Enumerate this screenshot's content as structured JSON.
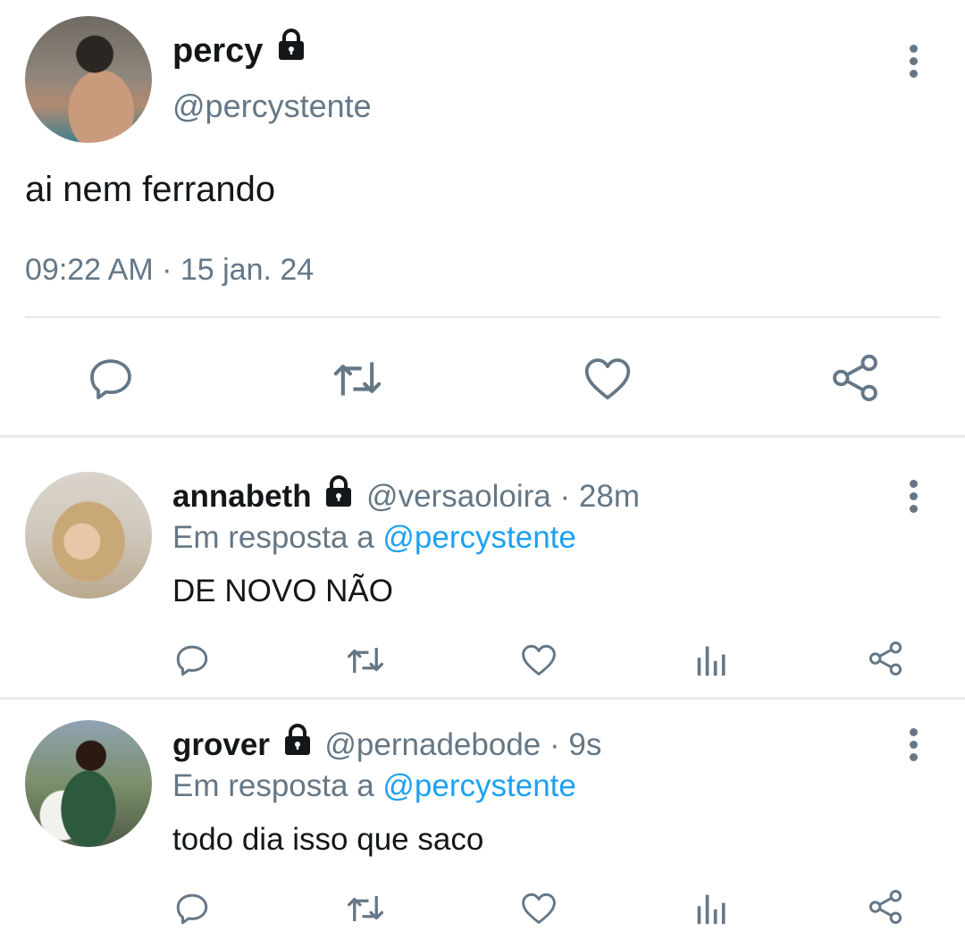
{
  "main_tweet": {
    "display_name": "percy",
    "handle": "@percystente",
    "text": "ai nem ferrando",
    "timestamp": "09:22 AM · 15 jan. 24"
  },
  "icons": {
    "lock": "lock-icon",
    "more": "more-vertical-icon",
    "reply": "reply-icon",
    "retweet": "retweet-icon",
    "like": "heart-icon",
    "views": "bar-chart-icon",
    "share": "share-icon"
  },
  "colors": {
    "text": "#14171a",
    "muted": "#657786",
    "link": "#1da1f2",
    "divider": "#e1e8ed"
  },
  "replies": [
    {
      "display_name": "annabeth",
      "handle": "@versaoloira",
      "time": "28m",
      "in_reply_prefix": "Em resposta a",
      "in_reply_to": "@percystente",
      "text": "DE NOVO NÃO"
    },
    {
      "display_name": "grover",
      "handle": "@pernadebode",
      "time": "9s",
      "in_reply_prefix": "Em resposta a",
      "in_reply_to": "@percystente",
      "text": "todo dia isso que saco"
    }
  ]
}
